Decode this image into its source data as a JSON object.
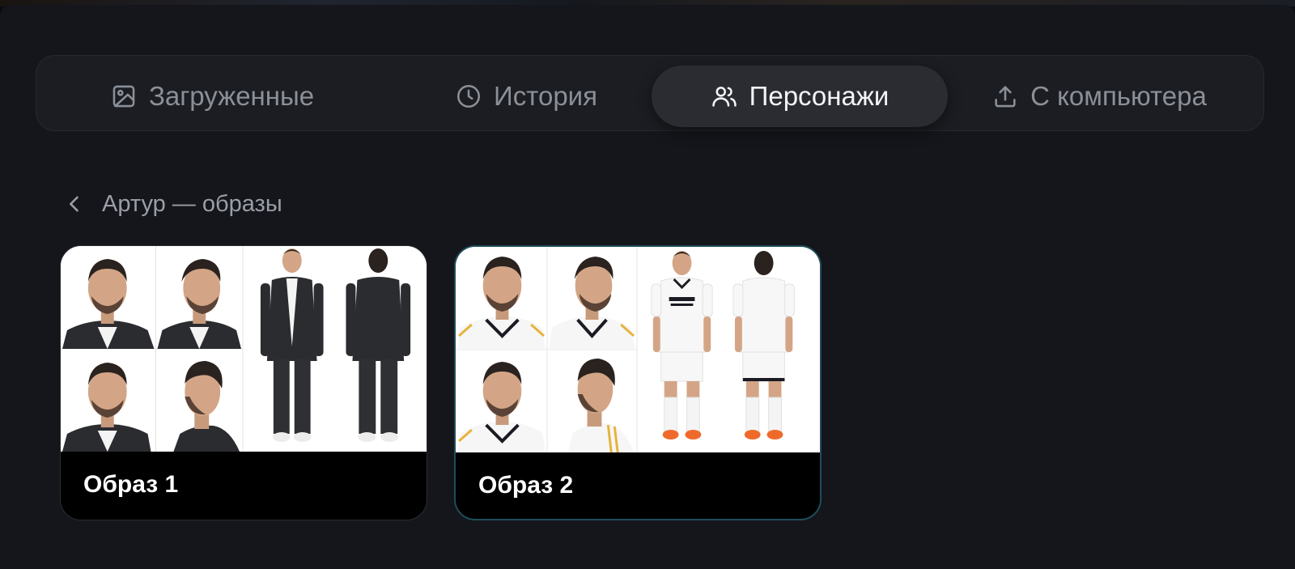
{
  "tabs": [
    {
      "label": "Загруженные",
      "icon": "image-icon",
      "active": false
    },
    {
      "label": "История",
      "icon": "clock-icon",
      "active": false
    },
    {
      "label": "Персонажи",
      "icon": "users-icon",
      "active": true
    },
    {
      "label": "С компьютера",
      "icon": "upload-icon",
      "active": false
    }
  ],
  "breadcrumb": {
    "title": "Артур — образы",
    "icon": "chevron-left-icon"
  },
  "cards": [
    {
      "label": "Образ 1",
      "outfit": "black suit with white t-shirt"
    },
    {
      "label": "Образ 2",
      "outfit": "white football kit",
      "selected": true
    }
  ],
  "colors": {
    "accent_border": "#1f4d5a",
    "active_tab": "#2a2c32",
    "panel": "#14161b"
  }
}
